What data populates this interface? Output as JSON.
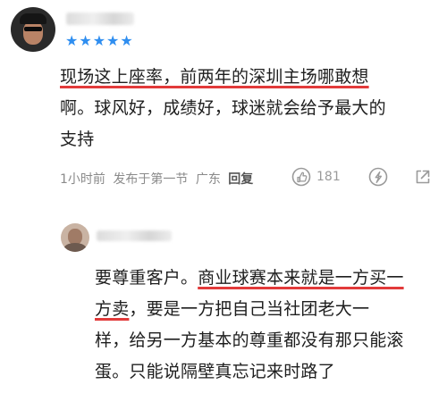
{
  "comments": [
    {
      "rating_stars": "★★★★★",
      "rating": 5,
      "body_lines": [
        [
          {
            "text": "现场这上座率，前两年的深圳主场哪敢想",
            "underline": true
          }
        ],
        [
          {
            "text": "啊。球风好，成绩好，球迷就会给予最大的",
            "underline": false
          }
        ],
        [
          {
            "text": "支持",
            "underline": false
          }
        ]
      ],
      "meta": {
        "time": "1小时前",
        "source": "发布于第一节",
        "location": "广东",
        "reply_label": "回复"
      },
      "like_count": "181",
      "icons": {
        "like": "thumb-up-icon",
        "share_wechat": "wechat-icon",
        "share_out": "share-icon"
      }
    },
    {
      "body_lines": [
        [
          {
            "text": "要尊重客户。",
            "underline": false
          },
          {
            "text": "商业球赛本来就是一方买一",
            "underline": true
          }
        ],
        [
          {
            "text": "方卖",
            "underline": true
          },
          {
            "text": "，要是一方把自己当社团老大一",
            "underline": false
          }
        ],
        [
          {
            "text": "样，给另一方基本的尊重都没有那只能滚",
            "underline": false
          }
        ],
        [
          {
            "text": "蛋。只能说隔壁真忘记来时路了",
            "underline": false
          }
        ]
      ]
    }
  ],
  "colors": {
    "star": "#2f8ef0",
    "underline": "#e23a3a",
    "meta_text": "#8a8a8a",
    "body_text": "#1e1e1e"
  }
}
